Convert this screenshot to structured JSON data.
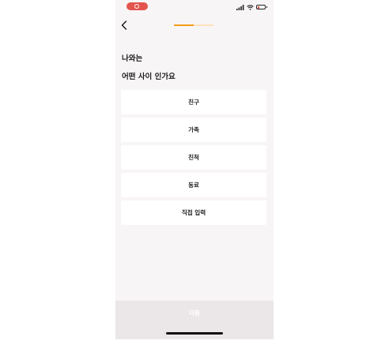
{
  "status_bar": {
    "recording_icon": "record-icon",
    "icons": [
      "cellular-signal-icon",
      "wifi-icon",
      "battery-low-icon"
    ]
  },
  "header": {
    "back_icon": "chevron-left-icon",
    "progress": 0.5
  },
  "question": {
    "line1": "나와는",
    "line2": "어떤 사이 인가요"
  },
  "options": [
    {
      "label": "친구"
    },
    {
      "label": "가족"
    },
    {
      "label": "친척"
    },
    {
      "label": "동료"
    },
    {
      "label": "직접 입력"
    }
  ],
  "footer": {
    "next_label": "다음",
    "enabled": false
  },
  "colors": {
    "accent": "#f29d17",
    "progress_track": "#fce2bd",
    "background": "#f8f5f6",
    "footer_disabled": "#ebe7e8",
    "record_pill": "#e2544c"
  }
}
